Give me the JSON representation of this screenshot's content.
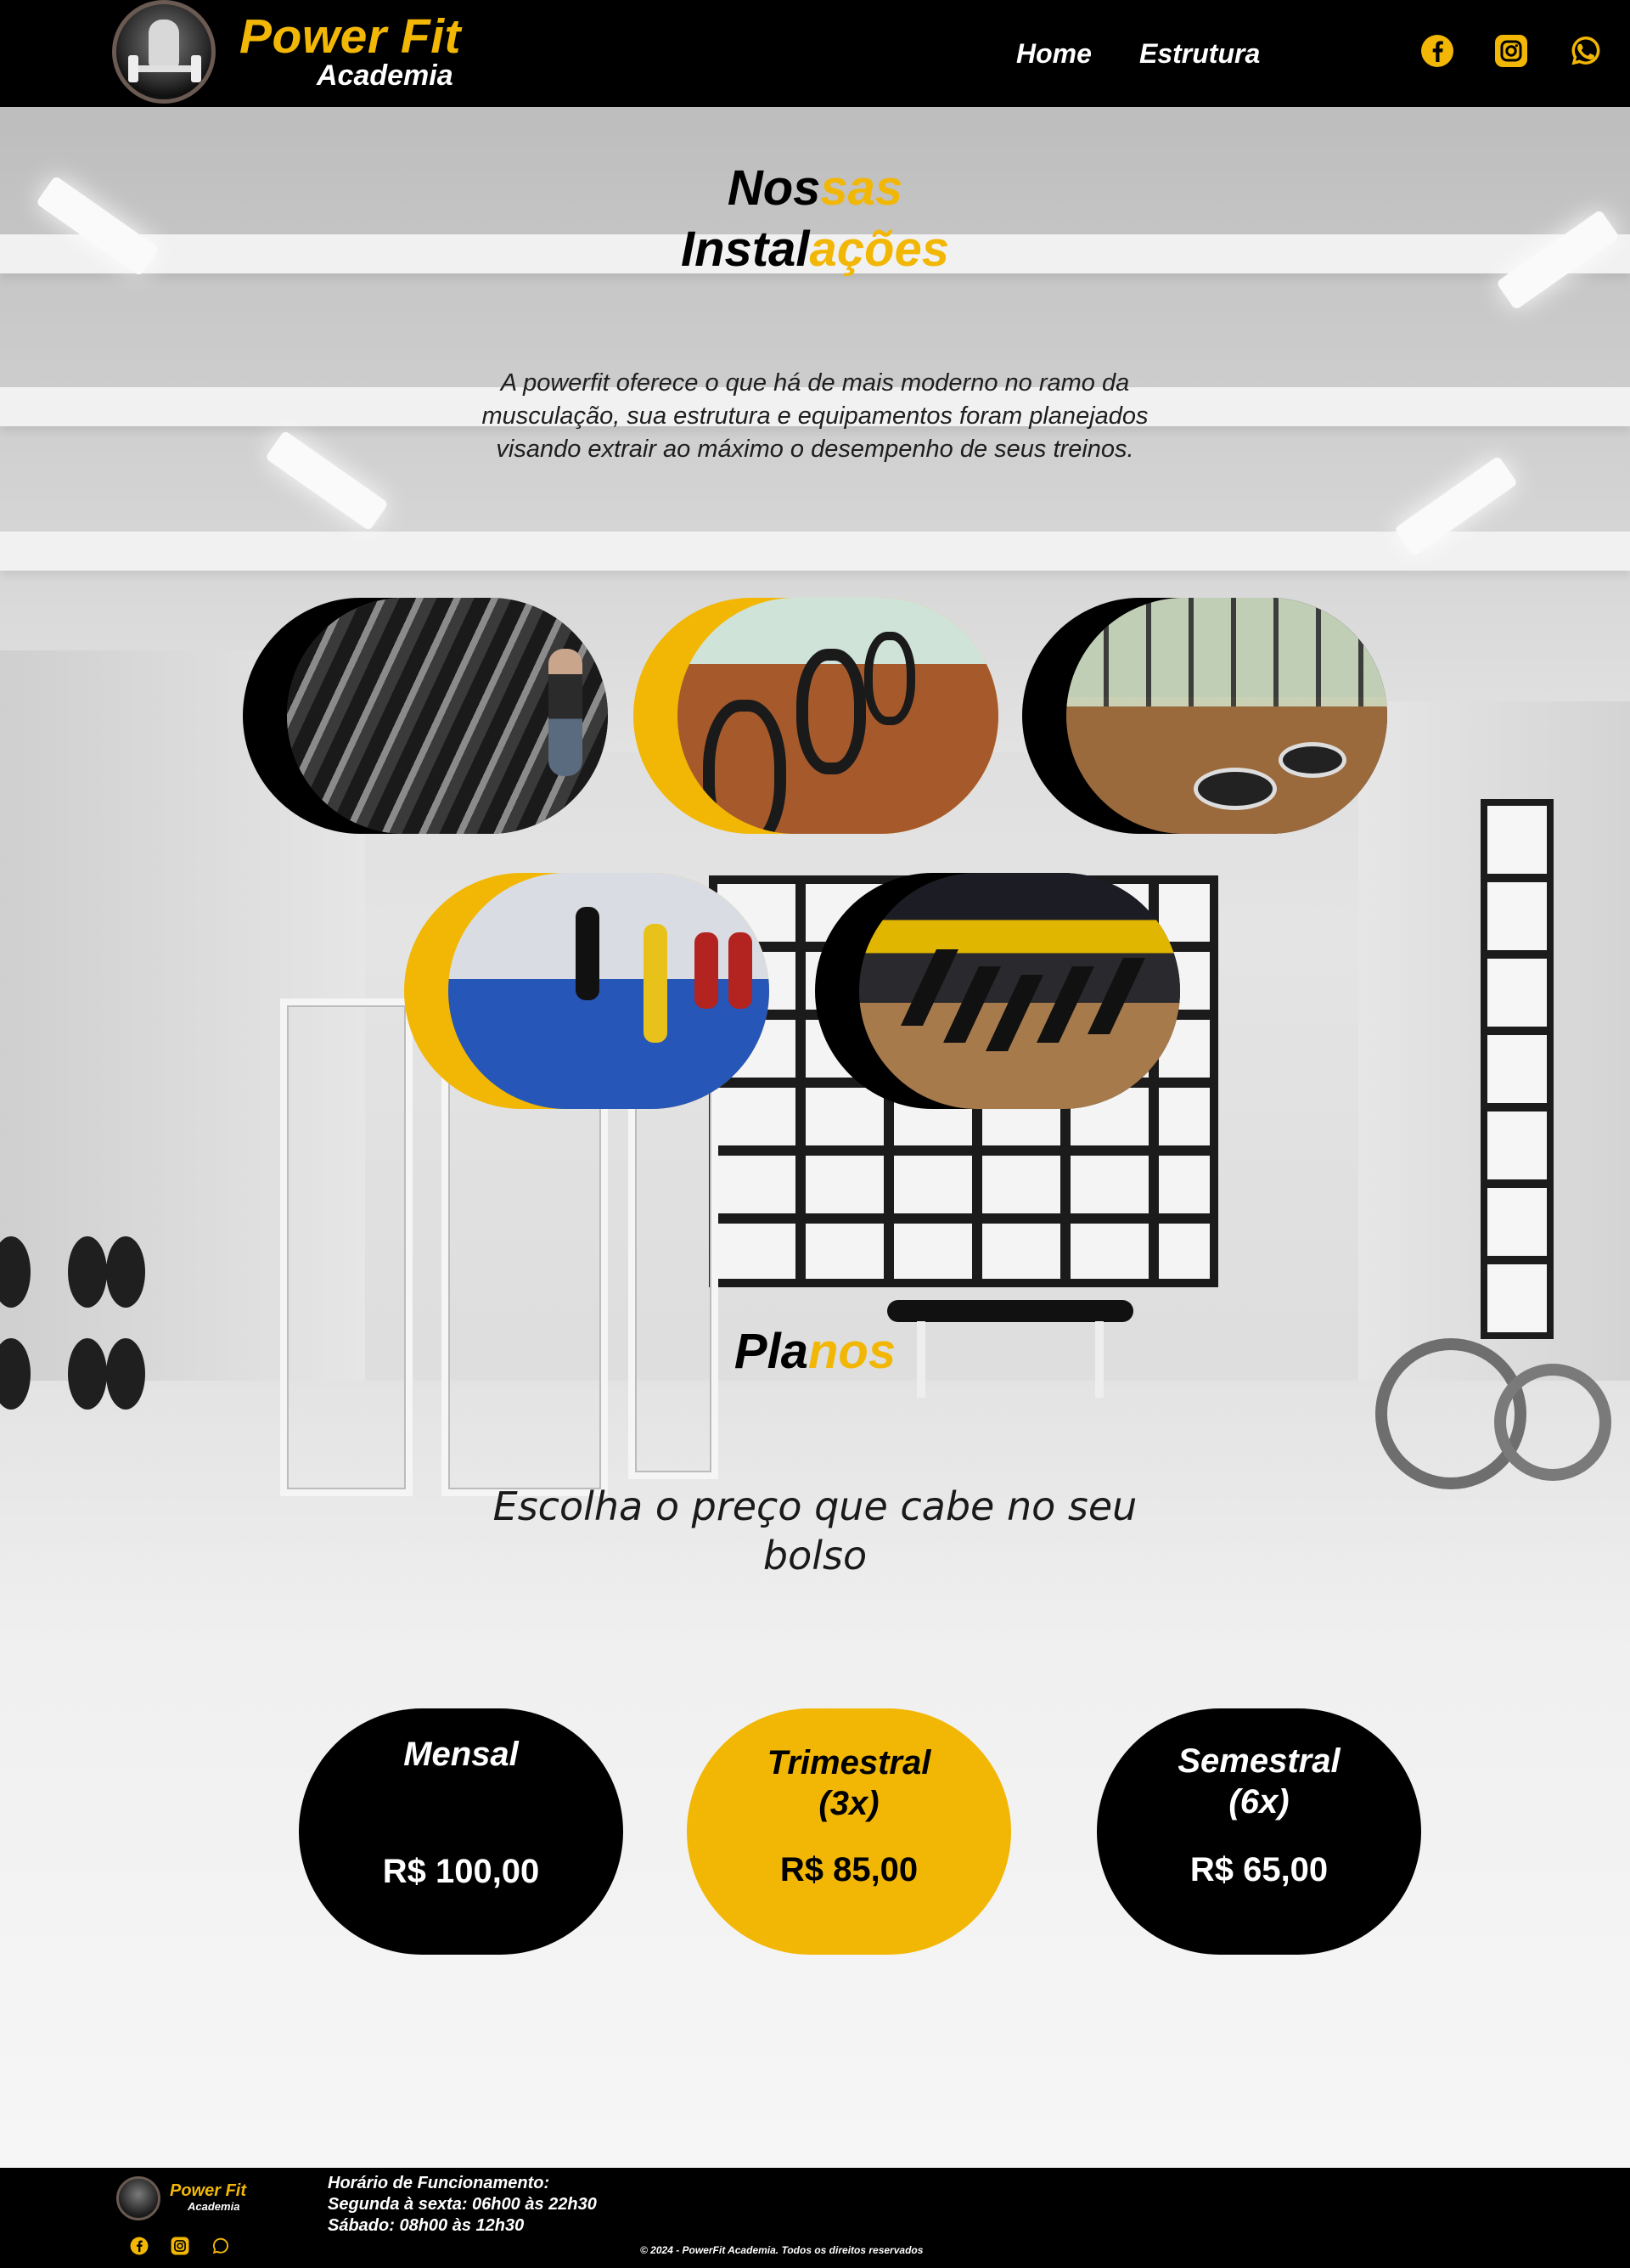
{
  "header": {
    "brand_title": "Power Fit",
    "brand_subtitle": "Academia",
    "nav": [
      {
        "label": "Home"
      },
      {
        "label": "Estrutura"
      }
    ],
    "social_icons": [
      "facebook-icon",
      "instagram-icon",
      "whatsapp-icon"
    ]
  },
  "instalacoes": {
    "title_part1": "Nos",
    "title_part2": "sas",
    "title_part3": "Instal",
    "title_part4": "ações",
    "description": "A powerfit oferece o que há de mais moderno no ramo da musculação, sua estrutura e equipamentos foram planejados visando extrair ao máximo o desempenho de seus treinos.",
    "photos": [
      "dumbbell-rack-photo",
      "cardio-area-photo",
      "functional-studio-photo",
      "boxing-area-photo",
      "weight-machines-photo"
    ]
  },
  "planos": {
    "title_part1": "Pla",
    "title_part2": "nos",
    "subtitle": "Escolha o preço que cabe no seu bolso",
    "plans": [
      {
        "name": "Mensal",
        "price": "R$ 100,00"
      },
      {
        "name": "Trimestral (3x)",
        "price": "R$ 85,00"
      },
      {
        "name": "Semestral (6x)",
        "price": "R$ 65,00"
      }
    ]
  },
  "footer": {
    "brand_title": "Power Fit",
    "brand_subtitle": "Academia",
    "hours_title": "Horário de Funcionamento:",
    "hours_weekdays": "Segunda à sexta: 06h00 às 22h30",
    "hours_saturday": "Sábado: 08h00 às 12h30",
    "copyright": "© 2024 - PowerFit Academia. Todos os direitos reservados"
  },
  "colors": {
    "accent": "#f2b705",
    "dark": "#000000",
    "light": "#ffffff"
  }
}
